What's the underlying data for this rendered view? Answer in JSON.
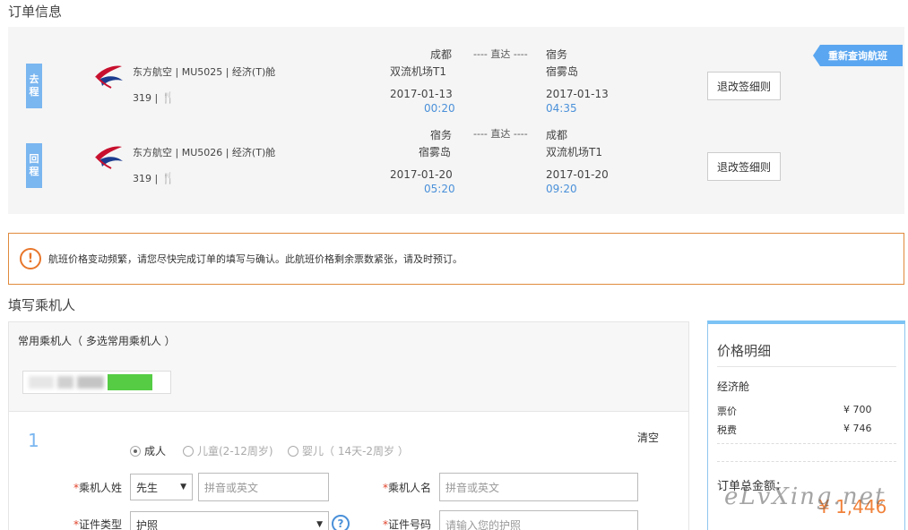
{
  "order_title": "订单信息",
  "requery_label": "重新查询航班",
  "legs": [
    {
      "tag": [
        "去",
        "程"
      ],
      "airline": "东方航空 | MU5025 | 经济(T)舱",
      "meta": "319 |",
      "dep_city": "成都",
      "dep_airport": "双流机场T1",
      "dep_date": "2017-01-13",
      "dep_time": "00:20",
      "direct": "---- 直达 ----",
      "arr_city": "宿务",
      "arr_airport": "宿雾岛",
      "arr_date": "2017-01-13",
      "arr_time": "04:35",
      "rule_btn": "退改签细则"
    },
    {
      "tag": [
        "回",
        "程"
      ],
      "airline": "东方航空 | MU5026 | 经济(T)舱",
      "meta": "319 |",
      "dep_city": "宿务",
      "dep_airport": "宿雾岛",
      "dep_date": "2017-01-20",
      "dep_time": "05:20",
      "direct": "---- 直达 ----",
      "arr_city": "成都",
      "arr_airport": "双流机场T1",
      "arr_date": "2017-01-20",
      "arr_time": "09:20",
      "rule_btn": "退改签细则"
    }
  ],
  "notice": "航班价格变动频繁，请您尽快完成订单的填写与确认。此航班价格剩余票数紧张，请及时预订。",
  "fill_title": "填写乘机人",
  "frequent_label": "常用乘机人（ 多选常用乘机人 ）",
  "passenger": {
    "index": "1",
    "clear": "清空",
    "types": [
      "成人",
      "儿童(2-12周岁)",
      "婴儿（ 14天-2周岁 ）"
    ],
    "surname_label": "乘机人姓",
    "title_value": "先生",
    "surname_placeholder": "拼音或英文",
    "given_label": "乘机人名",
    "given_placeholder": "拼音或英文",
    "id_type_label": "证件类型",
    "id_type_value": "护照",
    "id_no_label": "证件号码",
    "id_no_placeholder": "请输入您的护照"
  },
  "price": {
    "title": "价格明细",
    "cabin": "经济舱",
    "ticket_label": "票价",
    "ticket_value": "¥  700",
    "tax_label": "税费",
    "tax_value": "¥  746",
    "total_label": "订单总金额：",
    "total_value": "¥ 1,446"
  },
  "watermark": "eLvXing.net",
  "colors": {
    "accent": "#4a90d9",
    "tag": "#7ab6f0",
    "warning": "#e8762b",
    "total": "#f0813a"
  }
}
